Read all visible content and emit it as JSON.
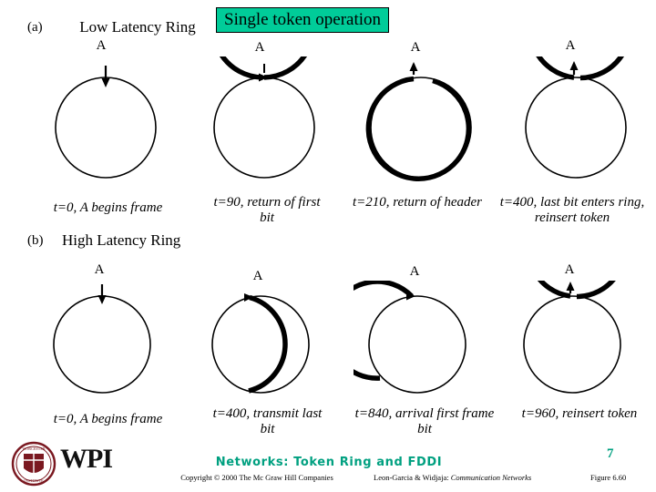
{
  "slide": {
    "banner": "Single token operation",
    "part_a": {
      "marker": "(a)",
      "title": "Low Latency Ring",
      "nodes": [
        {
          "label": "A",
          "caption": "t=0, A begins frame"
        },
        {
          "label": "A",
          "caption": "t=90, return of first bit"
        },
        {
          "label": "A",
          "caption": "t=210, return of header"
        },
        {
          "label": "A",
          "caption": "t=400, last bit enters ring, reinsert token"
        }
      ]
    },
    "part_b": {
      "marker": "(b)",
      "title": "High Latency Ring",
      "nodes": [
        {
          "label": "A",
          "caption": "t=0, A begins frame"
        },
        {
          "label": "A",
          "caption": "t=400, transmit last bit"
        },
        {
          "label": "A",
          "caption": "t=840, arrival first frame bit"
        },
        {
          "label": "A",
          "caption": "t=960, reinsert token"
        }
      ]
    },
    "footer": {
      "title": "Networks: Token Ring and FDDI",
      "copyright": "Copyright © 2000 The Mc Graw Hill Companies",
      "credit_authors": "Leon-Garcia & Widjaja:",
      "credit_book": "Communication Networks",
      "figure": "Figure 6.60",
      "page_number": "7",
      "logo_text": "WPI",
      "seal_line1": "WORCESTER",
      "seal_line2": "POLYTECHNIC",
      "seal_line3": "INSTITUTE"
    },
    "colors": {
      "banner_bg": "#00cc99",
      "footer_title": "#00a080",
      "ring_stroke": "#000000",
      "seal": "#7a1820"
    }
  }
}
